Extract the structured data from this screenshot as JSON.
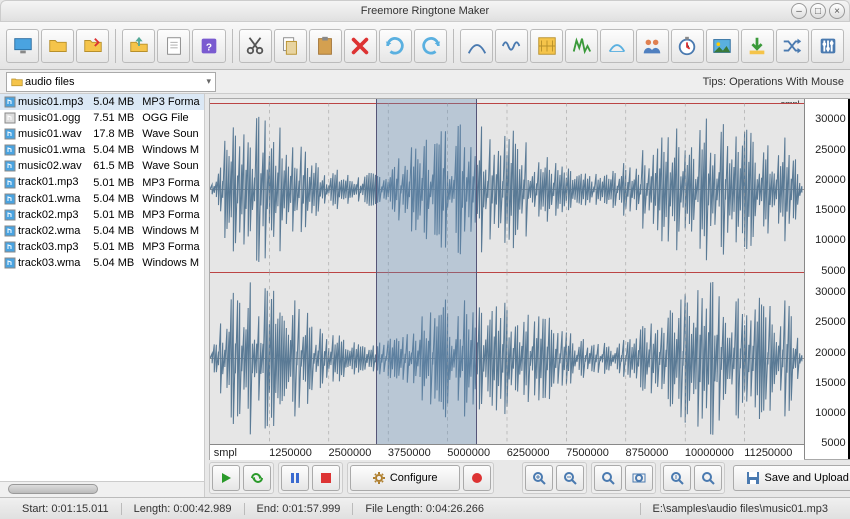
{
  "window": {
    "title": "Freemore Ringtone Maker"
  },
  "folder": {
    "name": "audio files",
    "icon": "folder-icon"
  },
  "tips": "Tips: Operations With Mouse",
  "files": [
    {
      "name": "music01.mp3",
      "size": "5.04 MB",
      "type": "MP3 Forma",
      "icon": "audio"
    },
    {
      "name": "music01.ogg",
      "size": "7.51 MB",
      "type": "OGG File",
      "icon": "doc"
    },
    {
      "name": "music01.wav",
      "size": "17.8 MB",
      "type": "Wave Soun",
      "icon": "audio"
    },
    {
      "name": "music01.wma",
      "size": "5.04 MB",
      "type": "Windows M",
      "icon": "audio"
    },
    {
      "name": "music02.wav",
      "size": "61.5 MB",
      "type": "Wave Soun",
      "icon": "audio"
    },
    {
      "name": "track01.mp3",
      "size": "5.01 MB",
      "type": "MP3 Forma",
      "icon": "audio"
    },
    {
      "name": "track01.wma",
      "size": "5.04 MB",
      "type": "Windows M",
      "icon": "audio"
    },
    {
      "name": "track02.mp3",
      "size": "5.01 MB",
      "type": "MP3 Forma",
      "icon": "audio"
    },
    {
      "name": "track02.wma",
      "size": "5.04 MB",
      "type": "Windows M",
      "icon": "audio"
    },
    {
      "name": "track03.mp3",
      "size": "5.01 MB",
      "type": "MP3 Forma",
      "icon": "audio"
    },
    {
      "name": "track03.wma",
      "size": "5.04 MB",
      "type": "Windows M",
      "icon": "audio"
    }
  ],
  "ruler_x": {
    "unit": "smpl",
    "ticks": [
      "1250000",
      "2500000",
      "3750000",
      "5000000",
      "6250000",
      "7500000",
      "8750000",
      "10000000",
      "11250000"
    ]
  },
  "ruler_y": {
    "unit": "smpl",
    "ticks": [
      "30000",
      "25000",
      "20000",
      "15000",
      "10000",
      "5000",
      "5000",
      "10000",
      "15000",
      "20000",
      "25000",
      "30000"
    ]
  },
  "selection": {
    "start_frac": 0.28,
    "end_frac": 0.45
  },
  "transport": {
    "configure": "Configure",
    "save": "Save and Upload"
  },
  "status": {
    "start_label": "Start:",
    "start": "0:01:15.011",
    "length_label": "Length:",
    "length": "0:00:42.989",
    "end_label": "End:",
    "end": "0:01:57.999",
    "file_length_label": "File Length:",
    "file_length": "0:04:26.266",
    "path": "E:\\samples\\audio files\\music01.mp3"
  },
  "chart_data": {
    "type": "waveform",
    "channels": 2,
    "x_unit": "samples",
    "x_range": [
      0,
      11750000
    ],
    "y_unit": "smpl",
    "y_range": [
      -32000,
      32000
    ],
    "selection_samples": [
      3300000,
      5200000
    ],
    "title": "",
    "xlabel": "smpl",
    "ylabel": "smpl"
  }
}
